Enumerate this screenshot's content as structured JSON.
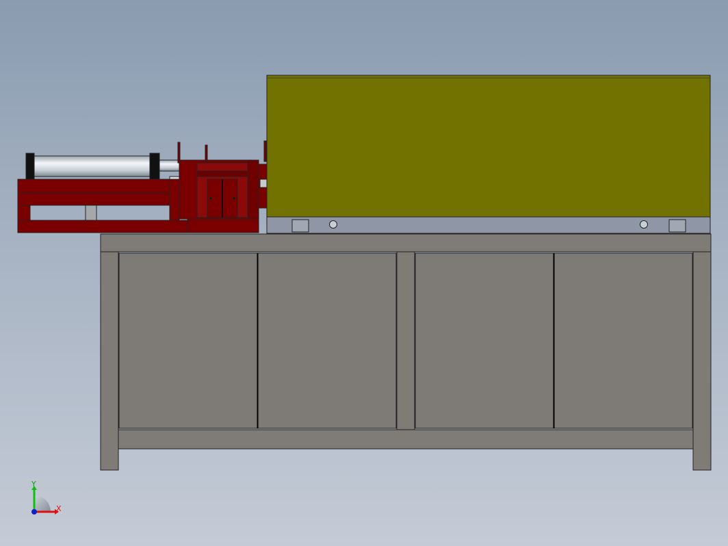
{
  "viewport": {
    "background_top": "#8a9bb0",
    "background_bottom": "#c4cbd6"
  },
  "triad": {
    "x_label": "X",
    "y_label": "Y",
    "x_color": "#e01010",
    "y_color": "#10c010",
    "z_color": "#1020d0"
  },
  "colors": {
    "cabinet_frame": "#7f7b76",
    "cabinet_outline": "#222222",
    "hood": "#727200",
    "hood_base": "#8f97a6",
    "red_frame": "#7a0000",
    "cylinder": "#d8dde2"
  }
}
